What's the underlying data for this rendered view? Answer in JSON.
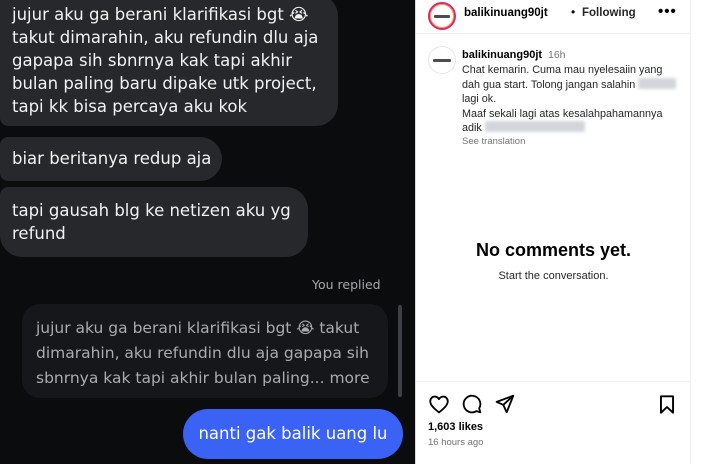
{
  "chat": {
    "messages": [
      {
        "lines": [
          "jujur aku ga berani klarifikasi bgt 😭",
          "takut dimarahin, aku refundin dlu aja",
          "gapapa sih sbnrnya kak tapi akhir",
          "bulan paling baru dipake utk project,",
          "tapi kk bisa percaya aku kok"
        ]
      },
      {
        "lines": [
          "biar beritanya redup aja"
        ]
      },
      {
        "lines": [
          "tapi gausah blg ke netizen aku yg",
          "refund"
        ]
      }
    ],
    "replied_label": "You replied",
    "quoted_lines": [
      "jujur aku ga berani klarifikasi bgt 😭 takut",
      "dimarahin, aku refundin dlu aja gapapa sih",
      "sbnrnya kak tapi akhir bulan paling... more"
    ],
    "sent_message": "nanti gak balik uang lu"
  },
  "post": {
    "header": {
      "username": "balikinuang90jt",
      "separator": "•",
      "follow_status": "Following",
      "more_icon": "more-horizontal-icon"
    },
    "caption": {
      "username": "balikinuang90jt",
      "time": "16h",
      "lines": [
        "Chat kemarin. Cuma mau nyelesaiin yang",
        "dah gua start. Tolong jangan salahin",
        "lagi ok.",
        "Maaf sekali lagi atas kesalahpahamannya",
        "adik"
      ],
      "see_translation": "See translation"
    },
    "empty_state": {
      "title": "No comments yet.",
      "subtitle": "Start the conversation."
    },
    "actions": {
      "like_icon": "heart-icon",
      "comment_icon": "comment-icon",
      "share_icon": "send-icon",
      "save_icon": "bookmark-icon"
    },
    "likes": "1,603 likes",
    "posted_ago": "16 hours ago"
  },
  "colors": {
    "chat_bg": "#0b0c0e",
    "received_bubble": "#26282c",
    "sent_bubble": "#3a62f5",
    "quote_bg": "#16171a",
    "ig_bg": "#ffffff",
    "ig_muted": "#737373"
  }
}
